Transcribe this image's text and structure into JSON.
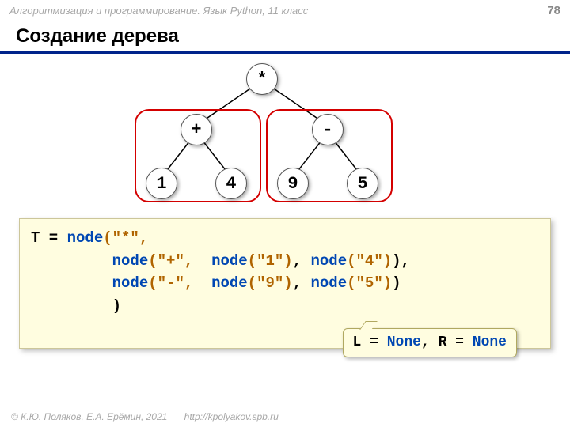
{
  "header": {
    "breadcrumb": "Алгоритмизация и программирование. Язык Python, 11 класс",
    "page_number": "78"
  },
  "title": "Создание дерева",
  "tree": {
    "root": "*",
    "left_op": "+",
    "right_op": "-",
    "l1": "1",
    "l2": "4",
    "r1": "9",
    "r2": "5"
  },
  "code": {
    "T": "T = ",
    "node": "node",
    "star": "(\"*\",",
    "plus": "(\"+\",  ",
    "one": "(\"1\")",
    "comma_sp": ", ",
    "four": "(\"4\")",
    "close_comma": "),",
    "minus": "(\"-\",  ",
    "nine": "(\"9\")",
    "five": "(\"5\")",
    "close": ")",
    "last": ")",
    "indent": "    ",
    "pad": "         "
  },
  "callout": {
    "lpart": "L = ",
    "none": "None",
    "mid": ", R = "
  },
  "footer": {
    "copyright": "© К.Ю. Поляков, Е.А. Ерёмин, 2021",
    "url": "http://kpolyakov.spb.ru"
  }
}
